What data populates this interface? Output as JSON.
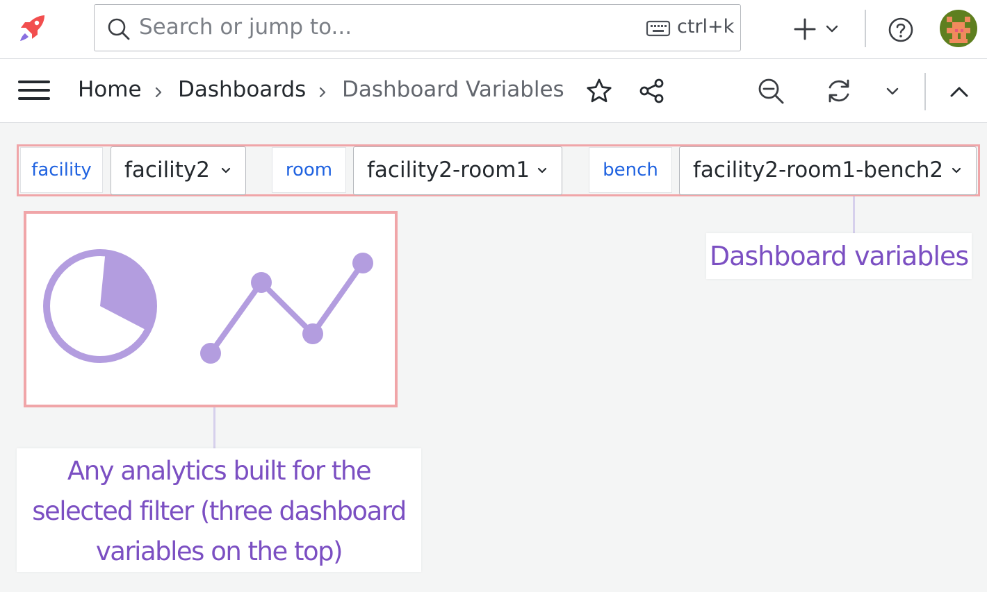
{
  "search": {
    "placeholder": "Search or jump to...",
    "shortcut": "ctrl+k"
  },
  "breadcrumb": {
    "home": "Home",
    "dashboards": "Dashboards",
    "current": "Dashboard Variables"
  },
  "variables": [
    {
      "label": "facility",
      "value": "facility2"
    },
    {
      "label": "room",
      "value": "facility2-room1"
    },
    {
      "label": "bench",
      "value": "facility2-room1-bench2"
    }
  ],
  "callouts": {
    "variables": "Dashboard variables",
    "analytics_lines": [
      "Any analytics built for the",
      "selected filter (three dashboard",
      "variables on the top)"
    ]
  },
  "icons": {
    "logo": "rocket-icon",
    "search": "search-icon",
    "keyboard": "keyboard-icon",
    "new": "plus-icon",
    "help": "help-icon",
    "menu": "hamburger-menu-icon",
    "star": "star-icon",
    "share": "share-icon",
    "zoom_out": "zoom-out-icon",
    "refresh": "refresh-icon",
    "collapse": "chevron-up-icon"
  },
  "colors": {
    "accent_blue": "#1f62e0",
    "highlight_border": "#f0a5a8",
    "annotation_purple": "#7b4fc2",
    "panel_graphic": "#b39ddf"
  }
}
